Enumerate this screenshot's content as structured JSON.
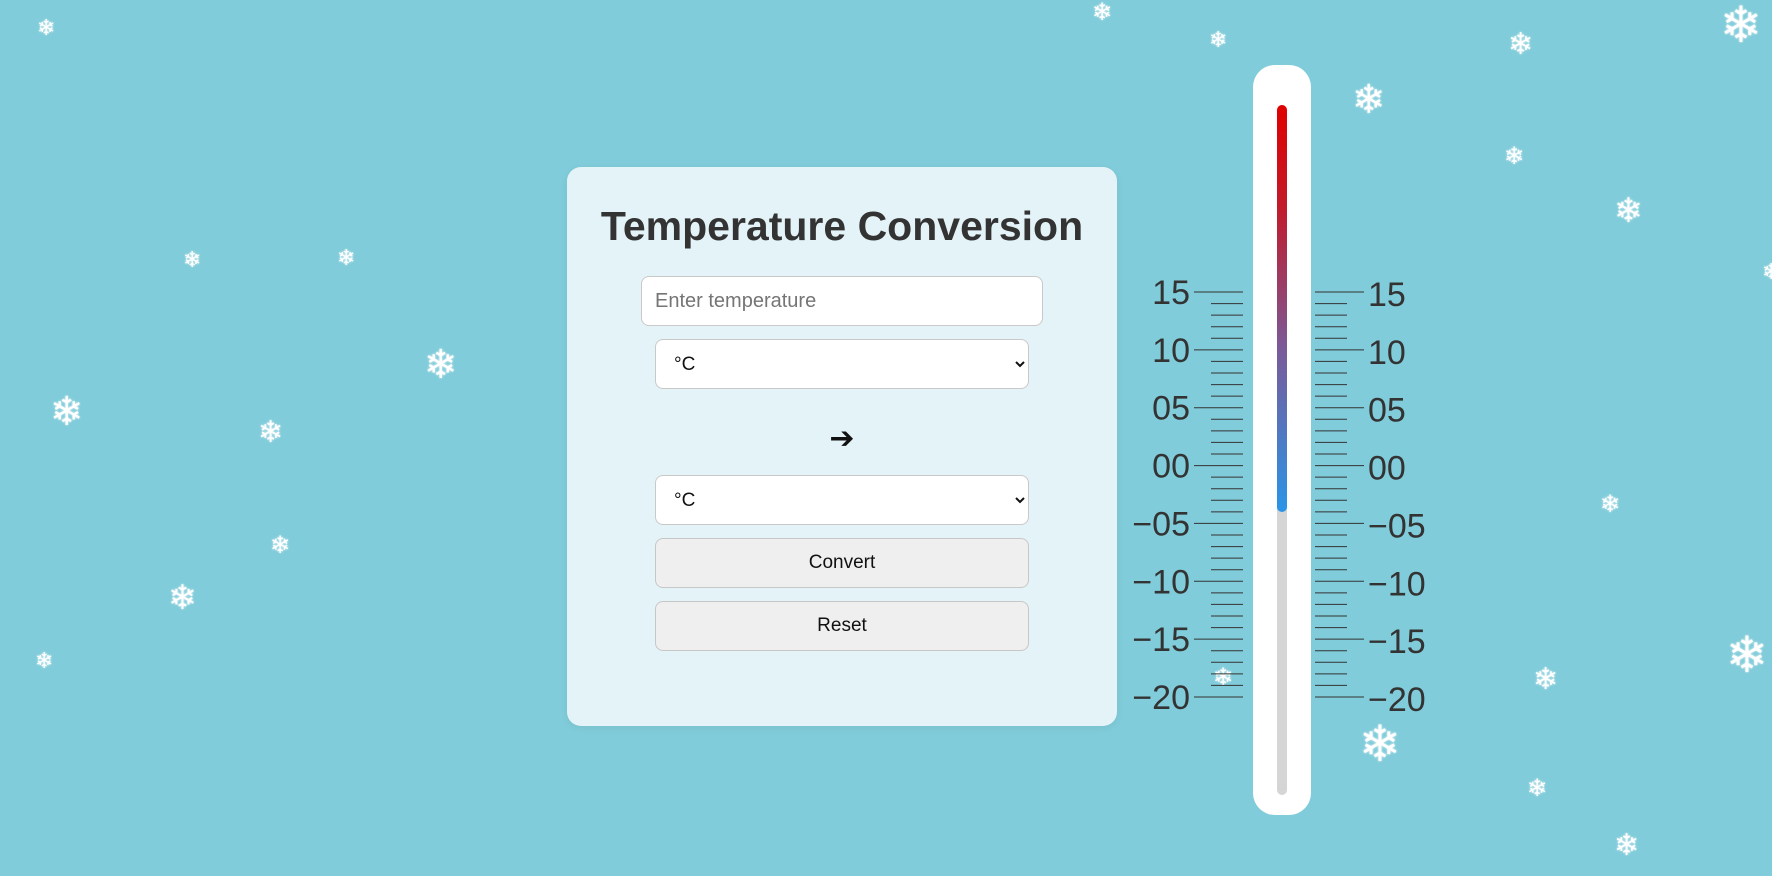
{
  "colors": {
    "background": "#80ccda",
    "card": "#e4f3f7",
    "mercury_top": "#e00000",
    "mercury_bottom": "#2a95e8"
  },
  "converter": {
    "title": "Temperature Conversion",
    "input": {
      "value": "",
      "placeholder": "Enter temperature"
    },
    "from_unit": {
      "selected": "°C"
    },
    "arrow_icon": "➔",
    "to_unit": {
      "selected": "°C"
    },
    "convert_label": "Convert",
    "reset_label": "Reset"
  },
  "thermometer": {
    "left_scale_labels": [
      "15",
      "10",
      "05",
      "00",
      "−05",
      "−10",
      "−15",
      "−20"
    ],
    "right_scale_labels": [
      "15",
      "10",
      "05",
      "00",
      "−05",
      "−10",
      "−15",
      "−20"
    ],
    "scale_range": [
      -20,
      15
    ],
    "mercury_level": 0.59
  },
  "decoration": {
    "snowflake_icon": "❄"
  }
}
